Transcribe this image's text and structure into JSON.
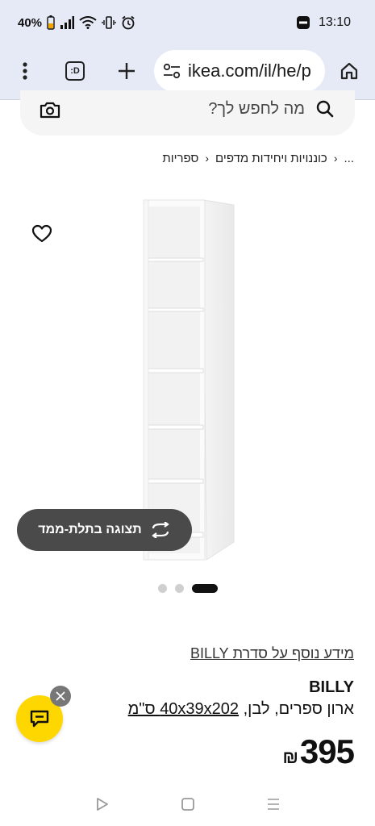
{
  "status_bar": {
    "battery": "40%",
    "time": "13:10"
  },
  "browser": {
    "url": "ikea.com/il/he/p",
    "tab_count_label": ":D",
    "icons": [
      "menu-dots-icon",
      "tab-switcher-icon",
      "new-tab-icon",
      "site-settings-icon",
      "home-icon"
    ]
  },
  "search": {
    "placeholder": "מה לחפש לך?"
  },
  "breadcrumb": {
    "items": [
      "...",
      "כוננויות ויחידות מדפים",
      "ספריות"
    ]
  },
  "gallery": {
    "view_3d_label": "תצוגה בתלת-ממד",
    "dots_count": 3,
    "active_dot": 0
  },
  "product": {
    "series_link": "מידע נוסף על סדרת BILLY",
    "name": "BILLY",
    "description_prefix": "ארון ספרים, לבן, ",
    "dimensions": "40x39x202 ס\"מ",
    "price_value": "395",
    "currency": "₪"
  },
  "colors": {
    "chrome_bg": "#e6eaf6",
    "chat_yellow": "#ffd700",
    "pill_dark": "#4a4a4a"
  }
}
